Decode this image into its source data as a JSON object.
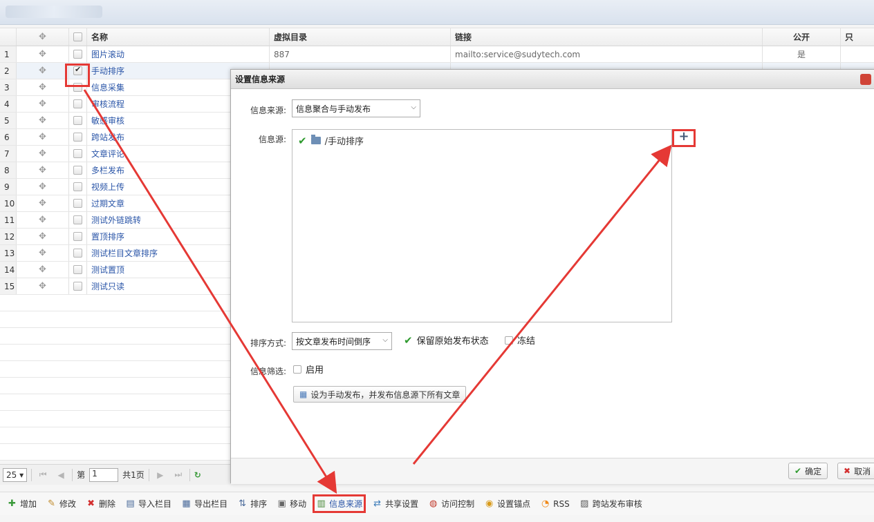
{
  "grid": {
    "columns": {
      "name": "名称",
      "dir": "虚拟目录",
      "link": "链接",
      "public": "公开",
      "last": "只"
    },
    "rows": [
      {
        "num": "1",
        "name": "图片滚动",
        "dir": "887",
        "link": "mailto:service@sudytech.com",
        "public": "是",
        "checked": false
      },
      {
        "num": "2",
        "name": "手动排序",
        "dir": "",
        "link": "",
        "public": "",
        "checked": true
      },
      {
        "num": "3",
        "name": "信息采集",
        "checked": false
      },
      {
        "num": "4",
        "name": "审核流程",
        "checked": false
      },
      {
        "num": "5",
        "name": "敏感审核",
        "checked": false
      },
      {
        "num": "6",
        "name": "跨站发布",
        "checked": false
      },
      {
        "num": "7",
        "name": "文章评论",
        "checked": false
      },
      {
        "num": "8",
        "name": "多栏发布",
        "checked": false
      },
      {
        "num": "9",
        "name": "视频上传",
        "checked": false
      },
      {
        "num": "10",
        "name": "过期文章",
        "checked": false
      },
      {
        "num": "11",
        "name": "测试外链跳转",
        "checked": false
      },
      {
        "num": "12",
        "name": "置顶排序",
        "checked": false
      },
      {
        "num": "13",
        "name": "测试栏目文章排序",
        "checked": false
      },
      {
        "num": "14",
        "name": "测试置顶",
        "checked": false
      },
      {
        "num": "15",
        "name": "测试只读",
        "checked": false
      }
    ]
  },
  "pager": {
    "page_size": "25",
    "page_prefix": "第",
    "page_value": "1",
    "page_suffix": "共1页"
  },
  "toolbar": {
    "add": "增加",
    "edit": "修改",
    "delete": "删除",
    "import": "导入栏目",
    "export": "导出栏目",
    "sort": "排序",
    "move": "移动",
    "info_source": "信息来源",
    "share": "共享设置",
    "access": "访问控制",
    "anchor": "设置锚点",
    "rss": "RSS",
    "cross_audit": "跨站发布审核"
  },
  "dialog": {
    "title": "设置信息来源",
    "source_label": "信息来源:",
    "source_value": "信息聚合与手动发布",
    "origin_label": "信息源:",
    "tree_item": "/手动排序",
    "add_symbol": "+",
    "sort_label": "排序方式:",
    "sort_value": "按文章发布时间倒序",
    "keep_status": "保留原始发布状态",
    "freeze": "冻结",
    "filter_label": "信息筛选:",
    "enable": "启用",
    "action_button": "设为手动发布，并发布信息源下所有文章",
    "ok": "确定",
    "cancel": "取消"
  },
  "colors": {
    "annotation": "#e53935",
    "link": "#2b56a8"
  }
}
